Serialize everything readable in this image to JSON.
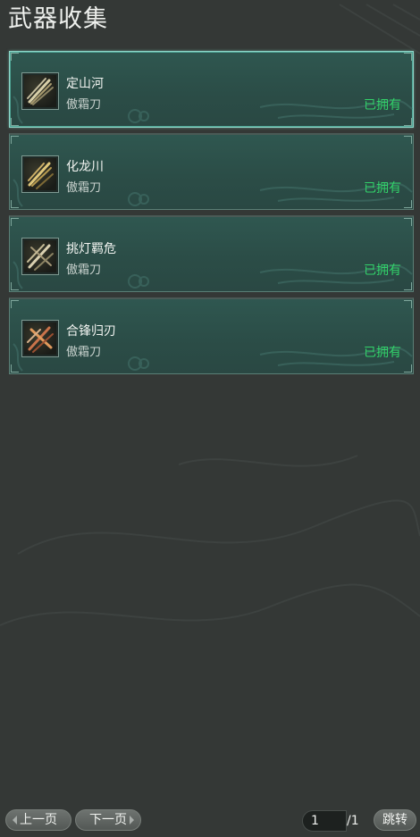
{
  "title": "武器收集",
  "weapons": [
    {
      "name": "定山河",
      "type": "傲霜刀",
      "status": "已拥有",
      "icon": "blade-bundle-icon",
      "selected": true
    },
    {
      "name": "化龙川",
      "type": "傲霜刀",
      "status": "已拥有",
      "icon": "golden-blade-icon",
      "selected": false
    },
    {
      "name": "挑灯羁危",
      "type": "傲霜刀",
      "status": "已拥有",
      "icon": "crossed-blades-icon",
      "selected": false
    },
    {
      "name": "合锋归刃",
      "type": "傲霜刀",
      "status": "已拥有",
      "icon": "red-crossed-blades-icon",
      "selected": false
    }
  ],
  "pagination": {
    "prev_label": "上一页",
    "next_label": "下一页",
    "current_page": "1",
    "total_pages": "/1",
    "jump_label": "跳转"
  },
  "colors": {
    "background": "#343836",
    "card": "#2d524b",
    "owned": "#32d36a",
    "selected_border": "#8fd6c8"
  }
}
